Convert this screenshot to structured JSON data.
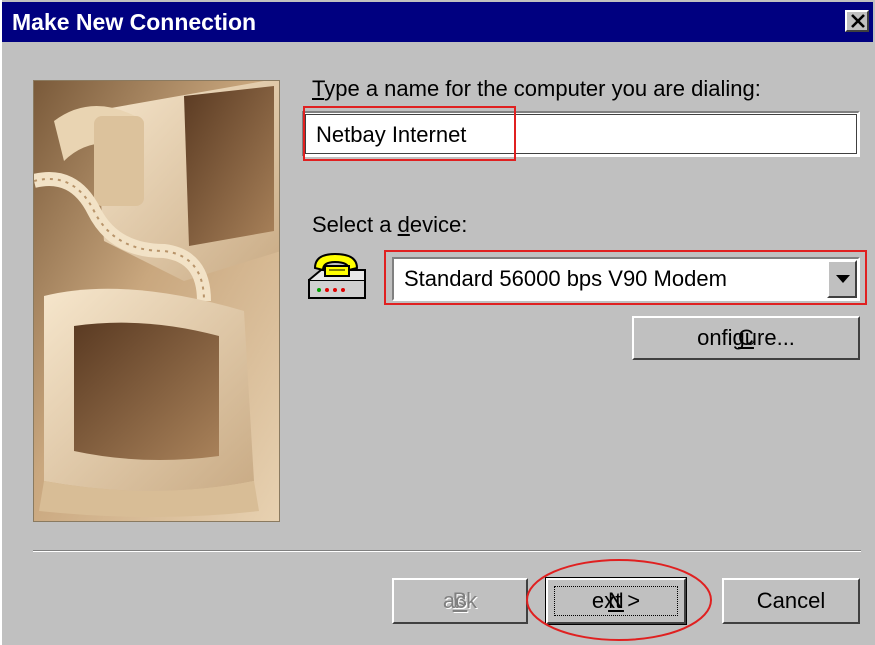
{
  "window": {
    "title": "Make New Connection"
  },
  "icons": {
    "close": "close-icon",
    "modem": "modem-icon",
    "dropdown": "chevron-down-icon"
  },
  "form": {
    "name_label_mnemonic": "T",
    "name_label_rest": "ype a name for the computer you are dialing:",
    "name_value": "Netbay Internet",
    "device_label_pre": "Select a ",
    "device_label_mnemonic": "d",
    "device_label_post": "evice:",
    "device_selected": "Standard 56000 bps V90 Modem",
    "configure_mnemonic": "C",
    "configure_rest": "onfigure..."
  },
  "buttons": {
    "back_pre": "< ",
    "back_mnemonic": "B",
    "back_rest": "ack",
    "next_mnemonic": "N",
    "next_rest": "ext >",
    "cancel": "Cancel"
  },
  "colors": {
    "titlebar": "#000080",
    "dialog": "#c0c0c0",
    "annotation": "#e02020"
  }
}
